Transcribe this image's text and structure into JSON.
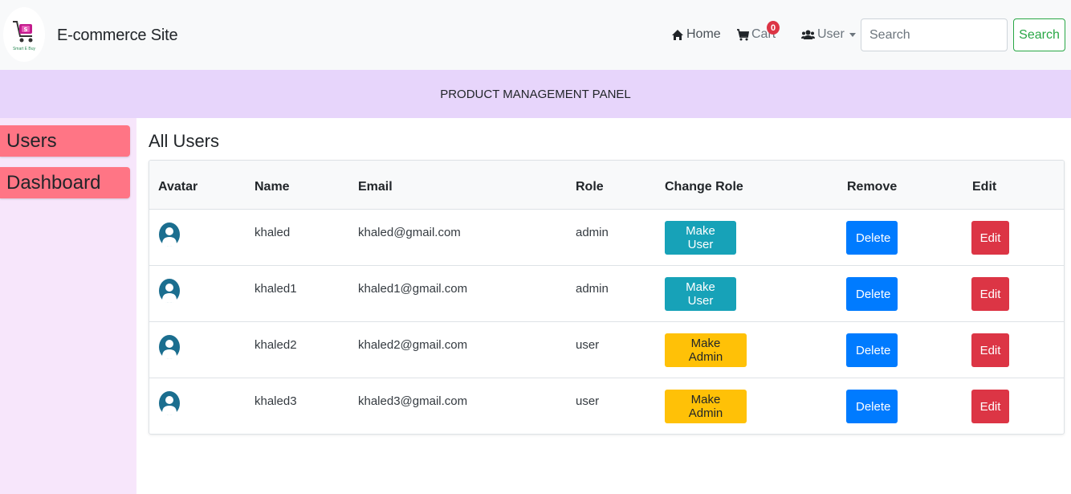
{
  "navbar": {
    "logo_text": "Smart E Buy",
    "brand": "E-commerce Site",
    "home_label": "Home",
    "cart_label": "Cart",
    "cart_count": "0",
    "user_label": "User",
    "search_placeholder": "Search",
    "search_button": "Search"
  },
  "banner": {
    "title": "PRODUCT MANAGEMENT PANEL"
  },
  "sidebar": {
    "items": [
      {
        "label": "Users"
      },
      {
        "label": "Dashboard"
      }
    ]
  },
  "main": {
    "title": "All Users",
    "columns": [
      "Avatar",
      "Name",
      "Email",
      "Role",
      "Change Role",
      "Remove",
      "Edit"
    ],
    "rows": [
      {
        "name": "khaled",
        "email": "khaled@gmail.com",
        "role": "admin",
        "change_role": "Make User",
        "remove": "Delete",
        "edit": "Edit"
      },
      {
        "name": "khaled1",
        "email": "khaled1@gmail.com",
        "role": "admin",
        "change_role": "Make User",
        "remove": "Delete",
        "edit": "Edit"
      },
      {
        "name": "khaled2",
        "email": "khaled2@gmail.com",
        "role": "user",
        "change_role": "Make Admin",
        "remove": "Delete",
        "edit": "Edit"
      },
      {
        "name": "khaled3",
        "email": "khaled3@gmail.com",
        "role": "user",
        "change_role": "Make Admin",
        "remove": "Delete",
        "edit": "Edit"
      }
    ]
  },
  "colors": {
    "navbar_bg": "#f8f9fa",
    "banner_bg": "#e7d5fb",
    "sidebar_bg": "#f7e6fb",
    "sidebar_item_bg": "#ff7585",
    "info": "#17a2b8",
    "warning": "#ffc107",
    "primary": "#007bff",
    "danger": "#dc3545",
    "success": "#28a745"
  }
}
